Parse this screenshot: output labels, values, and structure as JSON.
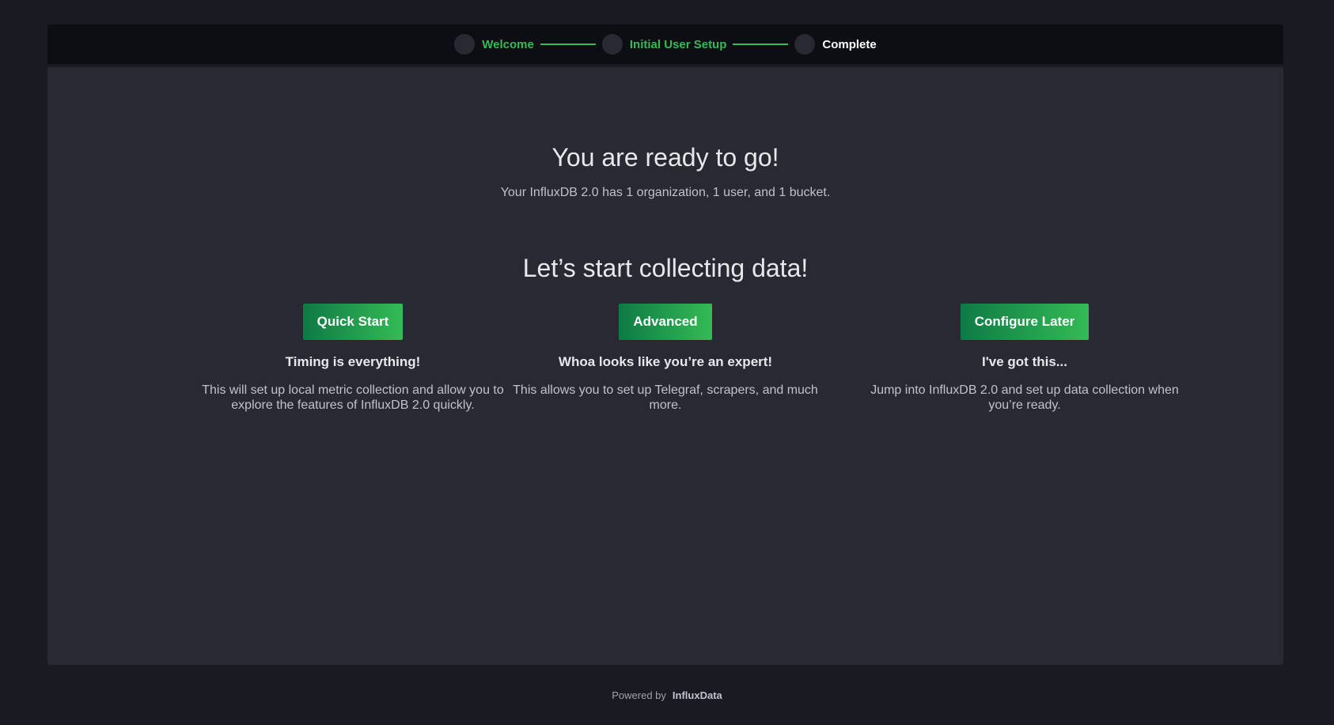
{
  "stepper": {
    "steps": [
      {
        "label": "Welcome",
        "state": "done"
      },
      {
        "label": "Initial User Setup",
        "state": "done"
      },
      {
        "label": "Complete",
        "state": "current"
      }
    ]
  },
  "main": {
    "ready_title": "You are ready to go!",
    "ready_subtitle": "Your InfluxDB 2.0 has 1 organization, 1 user, and 1 bucket.",
    "collect_title": "Let’s start collecting data!",
    "options": [
      {
        "button_label": "Quick Start",
        "heading": "Timing is everything!",
        "description": "This will set up local metric collection and allow you to explore the features of InfluxDB 2.0 quickly."
      },
      {
        "button_label": "Advanced",
        "heading": "Whoa looks like you’re an expert!",
        "description": "This allows you to set up Telegraf, scrapers, and much more."
      },
      {
        "button_label": "Configure Later",
        "heading": "I've got this...",
        "description": "Jump into InfluxDB 2.0 and set up data collection when you’re ready."
      }
    ]
  },
  "footer": {
    "powered_by": "Powered by",
    "brand": "InfluxData"
  },
  "colors": {
    "background": "#1a1a23",
    "panel": "#292933",
    "stepper_bg": "#0d0d14",
    "accent_green": "#34bb55",
    "button_gradient_start": "#0e7a45"
  }
}
